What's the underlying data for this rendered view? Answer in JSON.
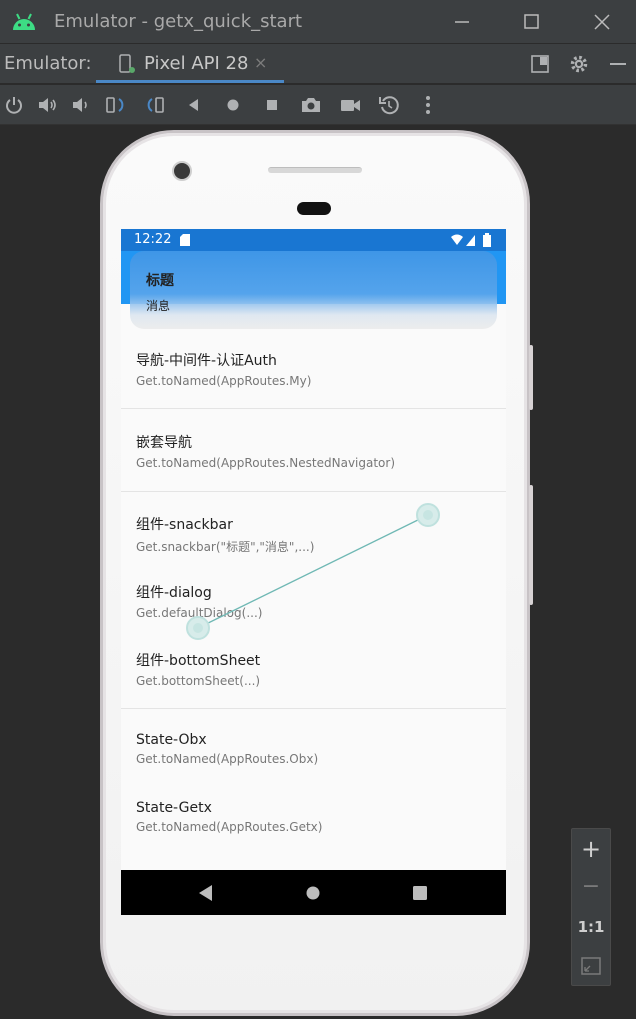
{
  "window": {
    "title": "Emulator - getx_quick_start"
  },
  "tabbar": {
    "label": "Emulator:",
    "tab_name": "Pixel API 28",
    "tab_close": "×"
  },
  "device": {
    "status_time": "12:22",
    "snackbar": {
      "title": "标题",
      "message": "消息"
    },
    "list": [
      {
        "title": "导航-中间件-认证Auth",
        "subtitle": "Get.toNamed(AppRoutes.My)"
      },
      {
        "title": "嵌套导航",
        "subtitle": "Get.toNamed(AppRoutes.NestedNavigator)"
      },
      {
        "title": "组件-snackbar",
        "subtitle": "Get.snackbar(\"标题\",\"消息\",...)"
      },
      {
        "title": "组件-dialog",
        "subtitle": "Get.defaultDialog(...)"
      },
      {
        "title": "组件-bottomSheet",
        "subtitle": "Get.bottomSheet(...)"
      },
      {
        "title": "State-Obx",
        "subtitle": "Get.toNamed(AppRoutes.Obx)"
      },
      {
        "title": "State-Getx",
        "subtitle": "Get.toNamed(AppRoutes.Getx)"
      }
    ]
  },
  "zoom": {
    "in": "+",
    "out": "−",
    "one_to_one": "1:1"
  },
  "colors": {
    "accent": "#4a88c7",
    "status_bar": "#1976d2",
    "app_bar": "#2196f3",
    "android_green": "#3ddc84"
  }
}
